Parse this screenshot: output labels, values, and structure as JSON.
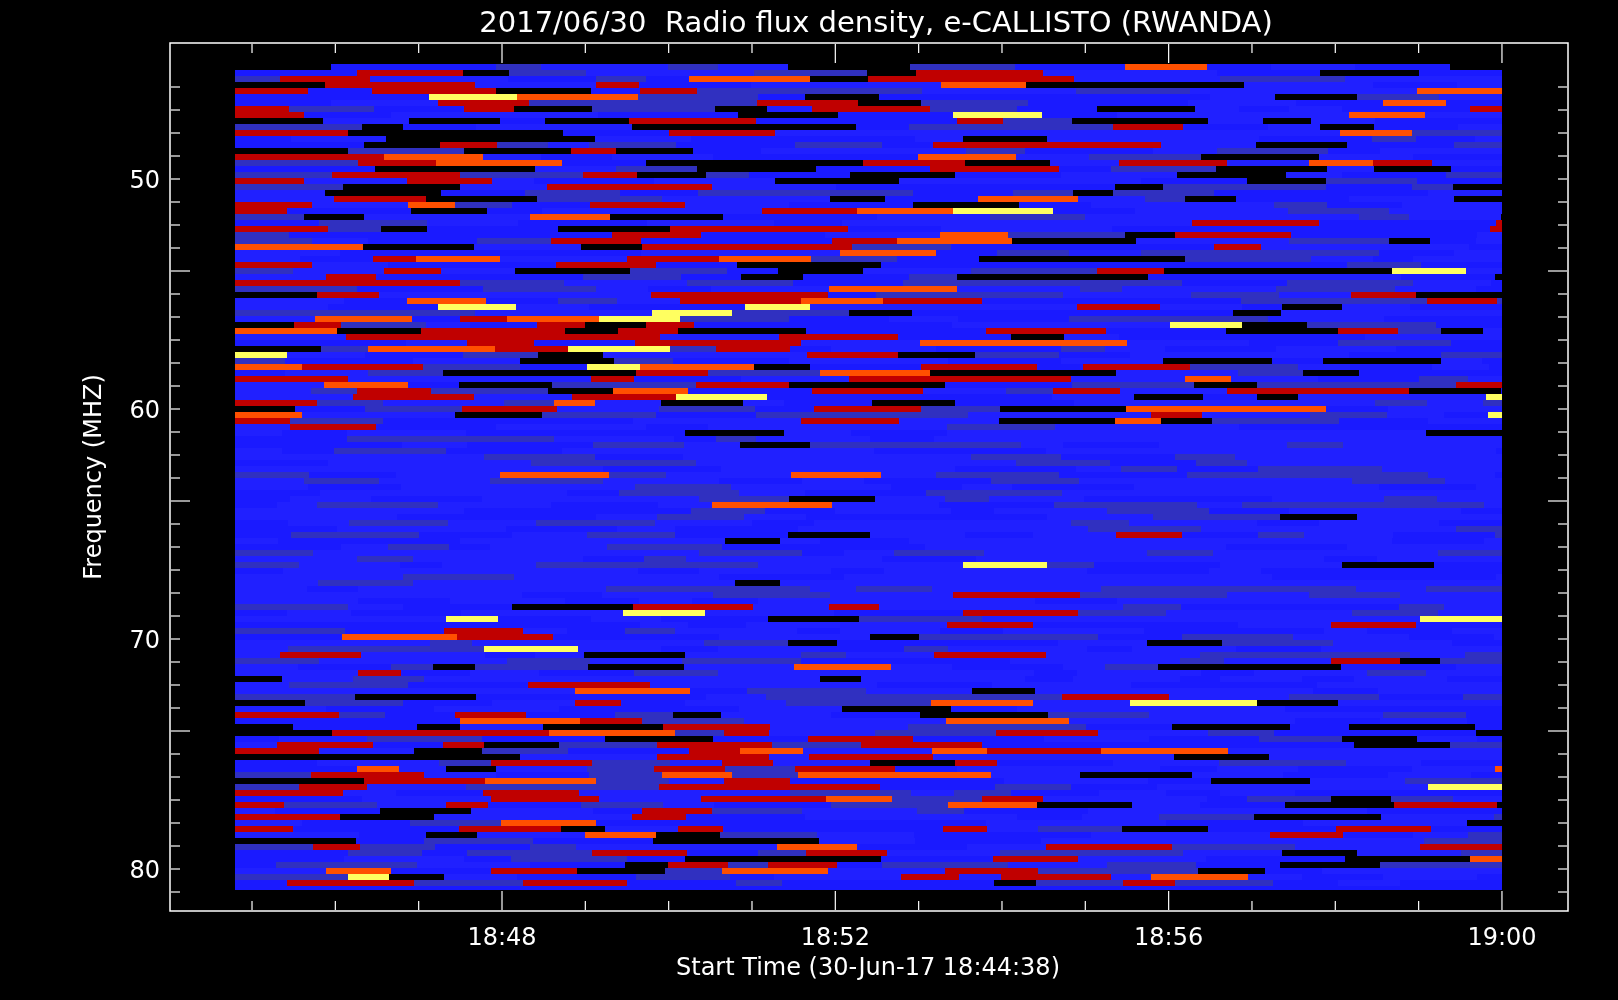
{
  "title": "2017/06/30  Radio flux density, e-CALLISTO (RWANDA)",
  "ylabel": "Frequency (MHZ)",
  "yticks": [
    "50",
    "60",
    "70",
    "80"
  ],
  "xticks": [
    "18:48",
    "18:52",
    "18:56",
    "19:00"
  ],
  "xlabel": "Start Time (30-Jun-17 18:44:38)"
}
